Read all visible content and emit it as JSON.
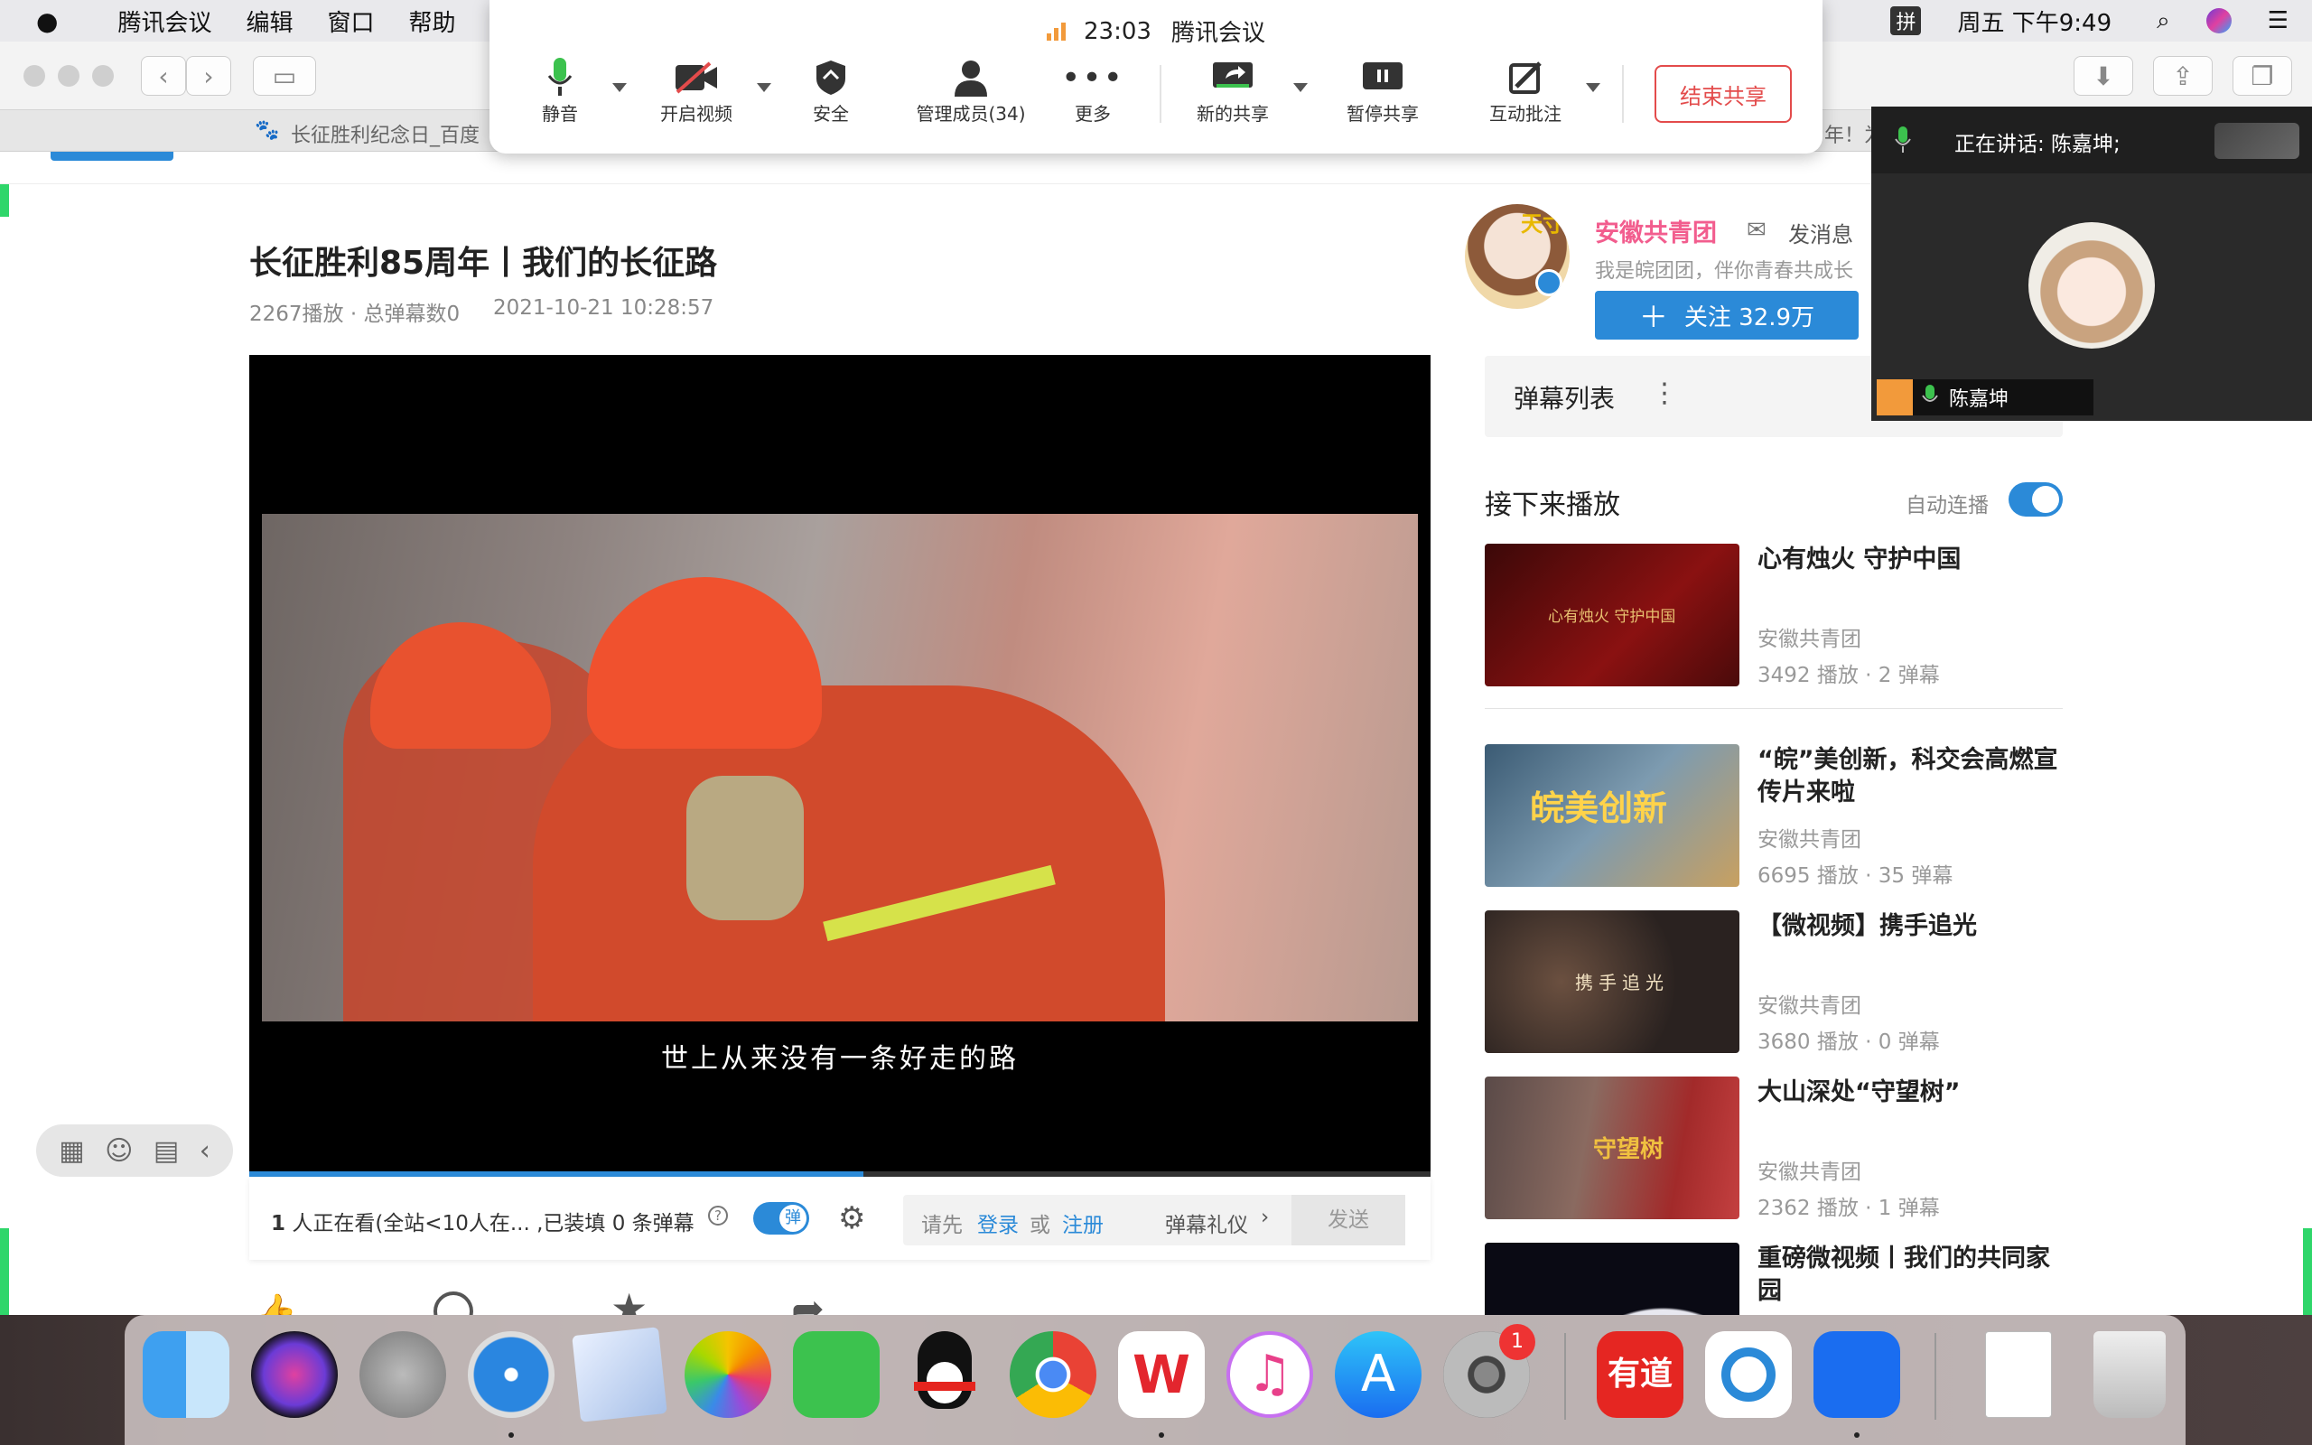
{
  "menubar": {
    "items": [
      "腾讯会议",
      "编辑",
      "窗口",
      "帮助"
    ],
    "clock": "周五 下午9:49",
    "ime": "拼"
  },
  "browser": {
    "tab_title": "长征胜利纪念日_百度",
    "tab_title_2": "年！为"
  },
  "meeting": {
    "timer": "23:03",
    "app_name": "腾讯会议",
    "mute": "静音",
    "video": "开启视频",
    "security": "安全",
    "members": "管理成员(34)",
    "more": "更多",
    "new_share": "新的共享",
    "pause_share": "暂停共享",
    "annotate": "互动批注",
    "end_share": "结束共享"
  },
  "video": {
    "title": "长征胜利85周年丨我们的长征路",
    "stats": "2267播放 · 总弹幕数0",
    "date": "2021-10-21 10:28:57",
    "subtitle": "世上从来没有一条好走的路",
    "viewers_count": "1",
    "viewers_text": " 人正在看(全站<10人在... ,已装填 0 条弹幕",
    "danmaku_toggle": "弹",
    "login_prompt": "请先",
    "login": "登录",
    "or": "或",
    "register": "注册",
    "etiquette": "弹幕礼仪",
    "send": "发送"
  },
  "uploader": {
    "name": "安徽共青团",
    "message": "发消息",
    "bio": "我是皖团团，伴你青春共成长",
    "follow": "关注 32.9万",
    "avatar_text": "天寸"
  },
  "danmaku_list": {
    "title": "弹幕列表"
  },
  "up_next": {
    "title": "接下来播放",
    "autoplay": "自动连播",
    "items": [
      {
        "title": "心有烛火 守护中国",
        "channel": "安徽共青团",
        "stats": "3492 播放 · 2 弹幕",
        "thumb_text": "心有烛火 守护中国"
      },
      {
        "title": "“皖”美创新，科交会高燃宣传片来啦",
        "channel": "安徽共青团",
        "stats": "6695 播放 · 35 弹幕",
        "thumb_text": "皖美创新"
      },
      {
        "title": "【微视频】携手追光",
        "channel": "安徽共青团",
        "stats": "3680 播放 · 0 弹幕",
        "thumb_text": "携手追光"
      },
      {
        "title": "大山深处“守望树”",
        "channel": "安徽共青团",
        "stats": "2362 播放 · 1 弹幕",
        "thumb_text": "守望树"
      },
      {
        "title": "重磅微视频丨我们的共同家园",
        "channel": "",
        "stats": "",
        "thumb_text": ""
      }
    ]
  },
  "speaker_panel": {
    "label": "正在讲话: 陈嘉坤;",
    "name": "陈嘉坤"
  },
  "dock": {
    "badge": "1",
    "youdao": "有道"
  },
  "colors": {
    "share_border": "#2fd66a",
    "accent_blue": "#2b8ad8",
    "end_red": "#e34b4b",
    "uploader_pink": "#f25d8e"
  }
}
